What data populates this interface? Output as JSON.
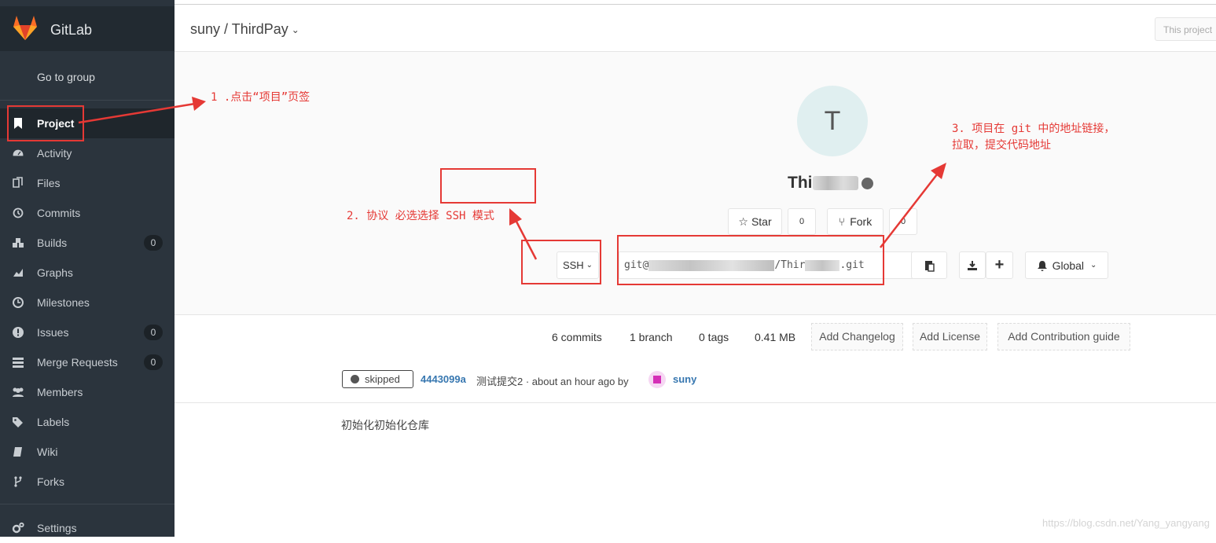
{
  "app": {
    "name": "GitLab"
  },
  "sidebar": {
    "goto_group": "Go to group",
    "items": [
      {
        "label": "Project",
        "icon": "bookmark-icon",
        "badge": null,
        "active": true
      },
      {
        "label": "Activity",
        "icon": "dashboard-icon",
        "badge": null
      },
      {
        "label": "Files",
        "icon": "files-icon",
        "badge": null
      },
      {
        "label": "Commits",
        "icon": "history-icon",
        "badge": null
      },
      {
        "label": "Builds",
        "icon": "cubes-icon",
        "badge": "0"
      },
      {
        "label": "Graphs",
        "icon": "area-chart-icon",
        "badge": null
      },
      {
        "label": "Milestones",
        "icon": "clock-icon",
        "badge": null
      },
      {
        "label": "Issues",
        "icon": "exclamation-circle-icon",
        "badge": "0"
      },
      {
        "label": "Merge Requests",
        "icon": "tasks-icon",
        "badge": "0"
      },
      {
        "label": "Members",
        "icon": "users-icon",
        "badge": null
      },
      {
        "label": "Labels",
        "icon": "tags-icon",
        "badge": null
      },
      {
        "label": "Wiki",
        "icon": "book-icon",
        "badge": null
      },
      {
        "label": "Forks",
        "icon": "code-fork-icon",
        "badge": null
      }
    ],
    "settings": "Settings"
  },
  "header": {
    "breadcrumb": "suny / ThirdPay",
    "search_placeholder": "This project"
  },
  "project": {
    "avatar_letter": "T",
    "name_visible": "Thi",
    "star_label": "Star",
    "star_count": "0",
    "fork_label": "Fork",
    "fork_count": "0",
    "protocol": "SSH",
    "clone_prefix": "git@",
    "clone_mid": "/Thir",
    "clone_suffix": ".git",
    "notification": "Global"
  },
  "stats": {
    "commits": "6 commits",
    "branch": "1 branch",
    "tags": "0 tags",
    "size": "0.41 MB",
    "add_changelog": "Add Changelog",
    "add_license": "Add License",
    "add_contribution": "Add Contribution guide"
  },
  "last_commit": {
    "status": "skipped",
    "sha": "4443099a",
    "message": "测试提交2 · about an hour ago by",
    "author": "suny"
  },
  "readme": "初始化初始化仓库",
  "annotations": {
    "step1": "1 .点击“项目”页签",
    "step2": "2. 协议 必选选择 SSH 模式",
    "step3_line1": "3. 项目在 git 中的地址链接，",
    "step3_line2": "拉取，提交代码地址"
  },
  "watermark": "https://blog.csdn.net/Yang_yangyang",
  "colors": {
    "sidebar": "#2b343d",
    "annotation": "#e53935",
    "link": "#3777b0"
  }
}
